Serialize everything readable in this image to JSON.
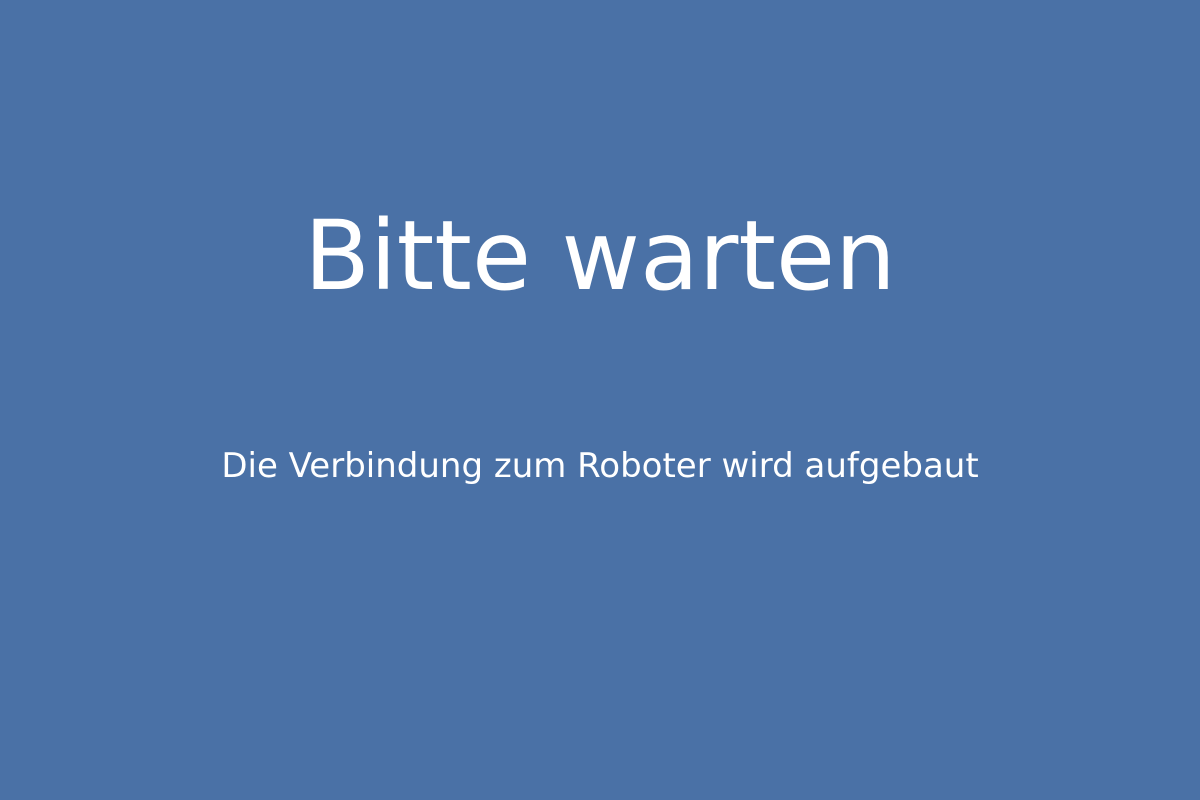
{
  "screen": {
    "title": "Bitte warten",
    "message": "Die Verbindung zum Roboter wird aufgebaut",
    "background_color": "#4a71a6",
    "text_color": "#ffffff"
  }
}
